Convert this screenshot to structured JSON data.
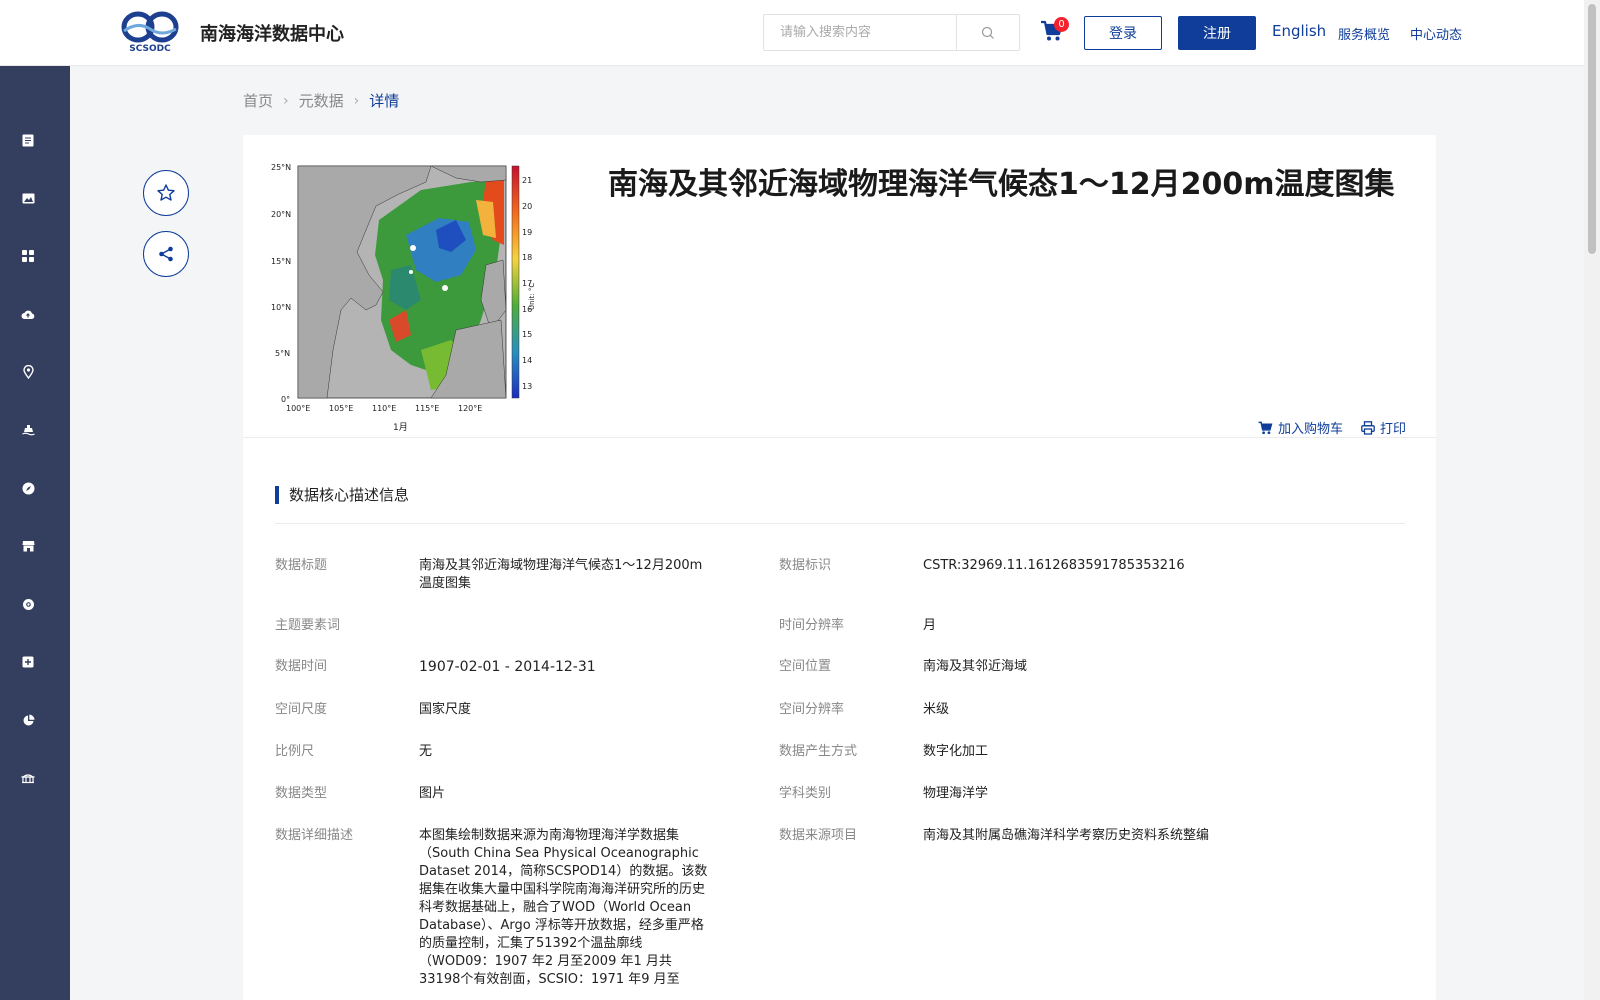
{
  "header": {
    "logo_text": "南海海洋数据中心",
    "search_placeholder": "请输入搜索内容",
    "cart_count": "0",
    "login": "登录",
    "register": "注册",
    "lang": "English",
    "nav_overview": "服务概览",
    "nav_news": "中心动态"
  },
  "sidebar": {
    "icons": [
      "document-icon",
      "image-icon",
      "apps-icon",
      "cloud-upload-icon",
      "location-icon",
      "ship-icon",
      "compass-icon",
      "store-icon",
      "settings-gear-icon",
      "add-icon",
      "pie-chart-icon",
      "bridge-icon"
    ]
  },
  "breadcrumb": {
    "home": "首页",
    "metadata": "元数据",
    "current": "详情"
  },
  "detail": {
    "title": "南海及其邻近海域物理海洋气候态1～12月200m温度图集",
    "thumbnail_caption": "1月",
    "add_to_cart": "加入购物车",
    "print": "打印"
  },
  "section": {
    "title": "数据核心描述信息"
  },
  "fields_left": [
    {
      "label": "数据标题",
      "value": "南海及其邻近海域物理海洋气候态1～12月200m温度图集"
    },
    {
      "label": "主题要素词",
      "value": ""
    },
    {
      "label": "数据时间",
      "value": "1907-02-01 - 2014-12-31"
    },
    {
      "label": "空间尺度",
      "value": "国家尺度"
    },
    {
      "label": "比例尺",
      "value": "无"
    },
    {
      "label": "数据类型",
      "value": "图片"
    },
    {
      "label": "数据详细描述",
      "value": "本图集绘制数据来源为南海物理海洋学数据集（South China Sea Physical Oceanographic Dataset 2014，简称SCSPOD14）的数据。该数据集在收集大量中国科学院南海海洋研究所的历史科考数据基础上，融合了WOD（World Ocean Database）、Argo 浮标等开放数据，经多重严格的质量控制，汇集了51392个温盐廓线（WOD09：1907 年2 月至2009 年1 月共33198个有效剖面，SCSIO：1971 年9 月至"
    }
  ],
  "fields_right": [
    {
      "label": "数据标识",
      "value": "CSTR:32969.11.1612683591785353216"
    },
    {
      "label": "时间分辨率",
      "value": "月"
    },
    {
      "label": "空间位置",
      "value": "南海及其邻近海域"
    },
    {
      "label": "空间分辨率",
      "value": "米级"
    },
    {
      "label": "数据产生方式",
      "value": "数字化加工"
    },
    {
      "label": "学科类别",
      "value": "物理海洋学"
    },
    {
      "label": "数据来源项目",
      "value": "南海及其附属岛礁海洋科学考察历史资料系统整编"
    }
  ],
  "thumbnail": {
    "lat_labels": [
      "25°N",
      "20°N",
      "15°N",
      "10°N",
      "5°N",
      "0°"
    ],
    "lon_labels": [
      "100°E",
      "105°E",
      "110°E",
      "115°E",
      "120°E"
    ],
    "colorbar_ticks": [
      "21",
      "20",
      "19",
      "18",
      "17",
      "16",
      "15",
      "14",
      "13"
    ],
    "unit": "Unit: °C"
  }
}
